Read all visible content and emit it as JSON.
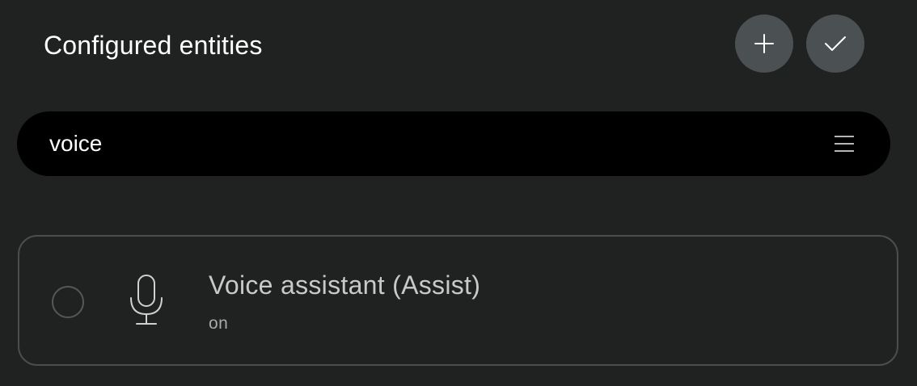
{
  "header": {
    "title": "Configured entities",
    "add_button_icon": "plus-icon",
    "confirm_button_icon": "check-icon"
  },
  "search": {
    "value": "voice",
    "filter_icon": "menu-lines-icon"
  },
  "entities": [
    {
      "name": "Voice assistant (Assist)",
      "state": "on",
      "icon": "microphone-icon",
      "selected": false
    }
  ],
  "colors": {
    "background": "#202121",
    "button": "#4b5152",
    "search_bg": "#000000",
    "card_border": "#4a4d4e",
    "entity_text": "#c8c9c9"
  }
}
